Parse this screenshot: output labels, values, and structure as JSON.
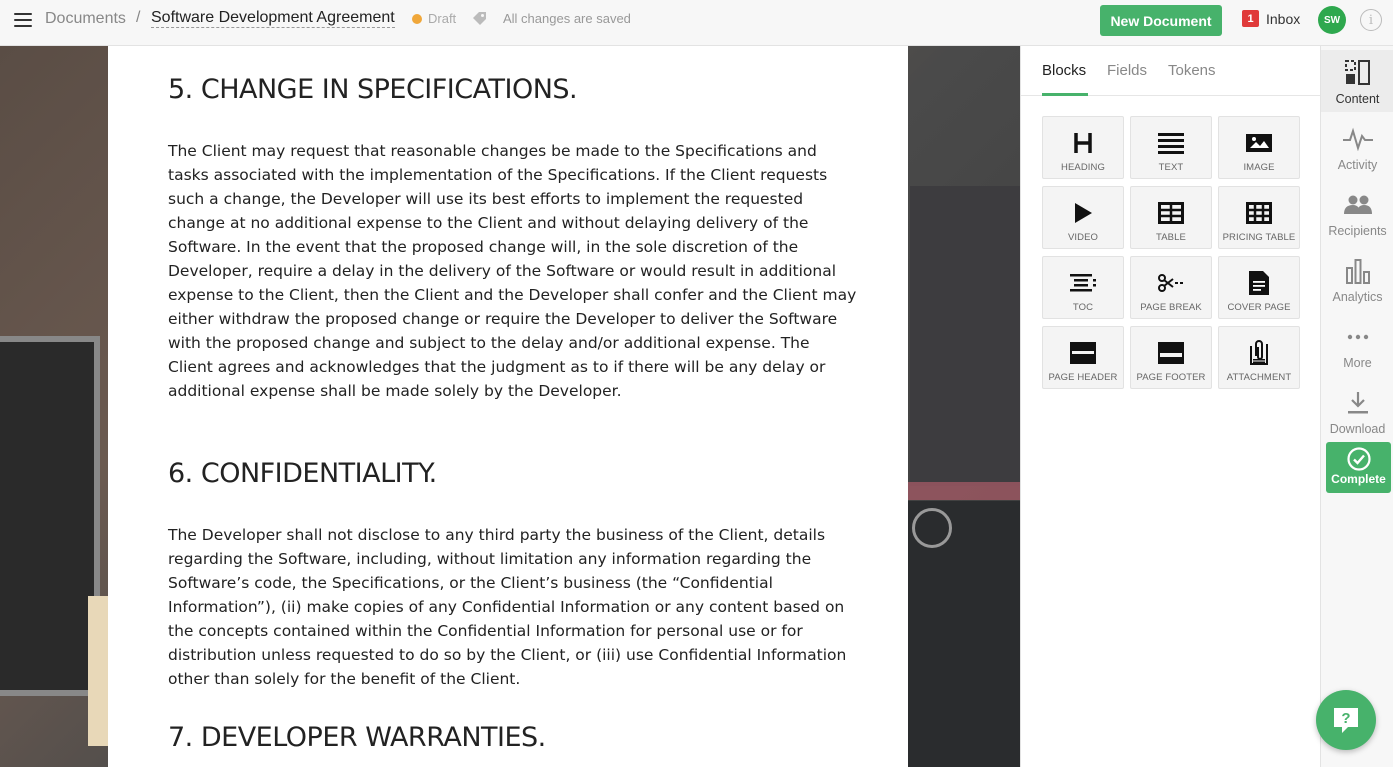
{
  "topbar": {
    "breadcrumb_root": "Documents",
    "separator": "/",
    "doc_title": "Software Development Agreement",
    "status": "Draft",
    "save_status": "All changes are saved",
    "new_document_label": "New Document",
    "inbox_count": "1",
    "inbox_label": "Inbox",
    "avatar_initials": "SW",
    "info_glyph": "i"
  },
  "document": {
    "sections": [
      {
        "heading": "5. CHANGE IN SPECIFICATIONS.",
        "body": "The Client may request that reasonable changes be made to the Specifications and tasks associated with the implementation of the Specifications. If the Client requests such a change, the Developer will use its best efforts to implement the requested change at no additional expense to the Client and without delaying delivery of the Software. In the event that the proposed change will, in the sole discretion of the Developer, require a delay in the delivery of the Software or would result in additional expense to the Client, then the Client and the Developer shall confer and the Client may either withdraw the proposed change or require the Developer to deliver the Software with the proposed change and subject to the delay and/or additional expense. The Client agrees and acknowledges that the judgment as to if there will be any delay or additional expense shall be made solely by the Developer."
      },
      {
        "heading": "6. CONFIDENTIALITY.",
        "body": "The Developer shall not disclose to any third party the business of the Client, details regarding the Software, including, without limitation any information regarding the Software’s code, the Specifications, or the Client’s business (the “Confidential Information”), (ii) make copies of any Confidential Information or any content based on the concepts contained within the Confidential Information for personal use or for distribution unless requested to do so by the Client, or (iii) use Confidential Information other than solely for the benefit of the Client."
      },
      {
        "heading": "7. DEVELOPER WARRANTIES."
      }
    ]
  },
  "panel": {
    "tabs": [
      "Blocks",
      "Fields",
      "Tokens"
    ],
    "active_tab": "Blocks",
    "blocks": [
      {
        "label": "HEADING",
        "icon": "heading-icon"
      },
      {
        "label": "TEXT",
        "icon": "text-icon"
      },
      {
        "label": "IMAGE",
        "icon": "image-icon"
      },
      {
        "label": "VIDEO",
        "icon": "video-icon"
      },
      {
        "label": "TABLE",
        "icon": "table-icon"
      },
      {
        "label": "PRICING TABLE",
        "icon": "pricing-table-icon"
      },
      {
        "label": "TOC",
        "icon": "toc-icon"
      },
      {
        "label": "PAGE BREAK",
        "icon": "page-break-icon"
      },
      {
        "label": "COVER PAGE",
        "icon": "cover-page-icon"
      },
      {
        "label": "PAGE HEADER",
        "icon": "page-header-icon"
      },
      {
        "label": "PAGE FOOTER",
        "icon": "page-footer-icon"
      },
      {
        "label": "ATTACHMENT",
        "icon": "attachment-icon"
      }
    ]
  },
  "sidebar": {
    "items": [
      {
        "label": "Content",
        "icon": "content-icon"
      },
      {
        "label": "Activity",
        "icon": "activity-icon"
      },
      {
        "label": "Recipients",
        "icon": "recipients-icon"
      },
      {
        "label": "Analytics",
        "icon": "analytics-icon"
      },
      {
        "label": "More",
        "icon": "more-icon"
      },
      {
        "label": "Download",
        "icon": "download-icon"
      }
    ],
    "complete_label": "Complete"
  },
  "help": {
    "glyph": "?"
  },
  "colors": {
    "accent": "#47b26b",
    "draft": "#f0a73a",
    "inbox_badge": "#e03a3a"
  }
}
